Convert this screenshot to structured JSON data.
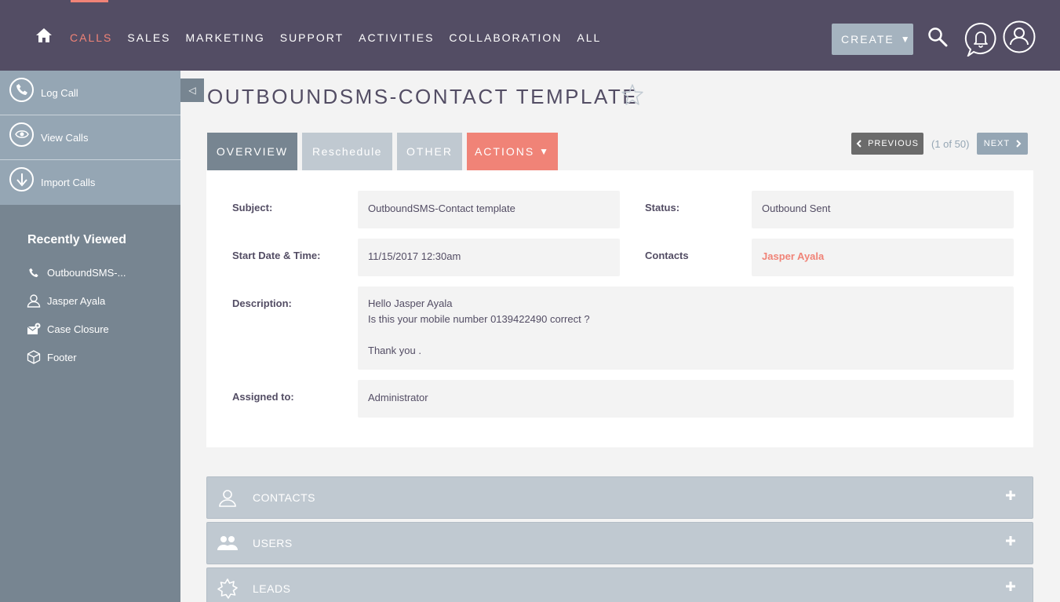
{
  "nav": {
    "items": [
      "CALLS",
      "SALES",
      "MARKETING",
      "SUPPORT",
      "ACTIVITIES",
      "COLLABORATION",
      "ALL"
    ],
    "create_label": "CREATE",
    "accent": "#f08377",
    "bar_color": "#534d64"
  },
  "sidebar": {
    "actions": [
      {
        "label": "Log Call",
        "icon": "phone-icon"
      },
      {
        "label": "View Calls",
        "icon": "eye-icon"
      },
      {
        "label": "Import Calls",
        "icon": "download-icon"
      }
    ],
    "recent_title": "Recently Viewed",
    "recent": [
      {
        "label": "OutboundSMS-...",
        "icon": "phone-icon"
      },
      {
        "label": "Jasper Ayala",
        "icon": "person-icon"
      },
      {
        "label": "Case Closure",
        "icon": "email-template-icon"
      },
      {
        "label": "Footer",
        "icon": "cube-icon"
      }
    ]
  },
  "page": {
    "title": "OUTBOUNDSMS-CONTACT TEMPLATE"
  },
  "tabs": {
    "overview": "OVERVIEW",
    "reschedule": "Reschedule",
    "other": "OTHER",
    "actions": "ACTIONS"
  },
  "pager": {
    "previous": "PREVIOUS",
    "count": "(1 of 50)",
    "next": "NEXT"
  },
  "detail": {
    "subject_label": "Subject:",
    "subject_value": "OutboundSMS-Contact template",
    "status_label": "Status:",
    "status_value": "Outbound Sent",
    "start_label": "Start Date & Time:",
    "start_value": "11/15/2017 12:30am",
    "contacts_label": "Contacts",
    "contacts_value": "Jasper Ayala",
    "description_label": "Description:",
    "description_lines": [
      "Hello Jasper Ayala",
      "Is this your mobile number 0139422490 correct ?",
      "",
      "Thank you ."
    ],
    "assigned_label": "Assigned to:",
    "assigned_value": "Administrator"
  },
  "subpanels": [
    {
      "label": "CONTACTS",
      "icon": "person-icon"
    },
    {
      "label": "USERS",
      "icon": "users-icon"
    },
    {
      "label": "LEADS",
      "icon": "lead-starburst-icon"
    }
  ]
}
